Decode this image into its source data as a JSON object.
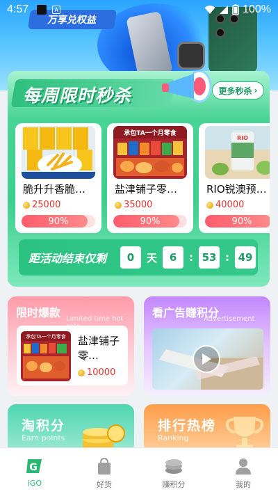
{
  "status_bar": {
    "time": "4:57",
    "battery": "100%"
  },
  "banner": {
    "tag_text": "万享兑权益"
  },
  "flash_sale": {
    "title": "每周限时秒杀",
    "more_label": "更多秒杀",
    "products": [
      {
        "name": "脆升升香脆…",
        "price": "25000",
        "progress_label": "90%",
        "progress": 0.9
      },
      {
        "name": "盐津铺子零…",
        "price": "35000",
        "progress_label": "90%",
        "progress": 0.9
      },
      {
        "name": "RIO锐澳预…",
        "price": "40000",
        "progress_label": "90%",
        "progress": 0.9
      }
    ],
    "countdown": {
      "label": "距活动结束仅剩",
      "days": "0",
      "day_unit": "天",
      "hours": "6",
      "minutes": "53",
      "seconds": "49",
      "sep": ":"
    }
  },
  "limited_deals": {
    "title": "限时爆款",
    "subtitle": "Limited time hot sale",
    "product_name": "盐津铺子零…",
    "product_price": "10000",
    "image_caption": "承包TA一个月零食"
  },
  "ad_points": {
    "title": "看广告赚积分",
    "subtitle": "Advertisement"
  },
  "earn_points": {
    "title": "淘积分",
    "subtitle": "Earn points"
  },
  "ranking": {
    "title": "排行热榜",
    "subtitle": "Ranking"
  },
  "product_image_captions": {
    "snack_banner": "承包TA一个月零食",
    "rio": "RIO"
  },
  "tabs": [
    {
      "label": "iGO",
      "icon": "igo-logo-icon",
      "active": true
    },
    {
      "label": "好货",
      "icon": "shopping-bag-icon",
      "active": false
    },
    {
      "label": "赚积分",
      "icon": "coins-icon",
      "active": false
    },
    {
      "label": "我的",
      "icon": "user-icon",
      "active": false
    }
  ],
  "colors": {
    "accent": "#2bb673",
    "price": "#e0352f",
    "flash_bg": "#3dcf8e"
  }
}
